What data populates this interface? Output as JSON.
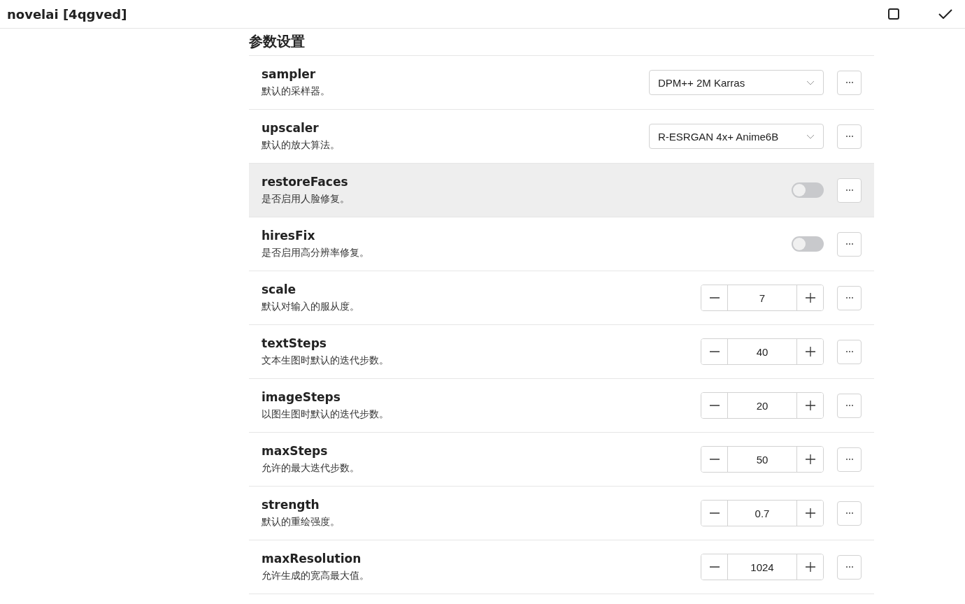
{
  "header": {
    "title": "novelai [4qgved]"
  },
  "section": {
    "title": "参数设置"
  },
  "settings": [
    {
      "name": "sampler",
      "description": "默认的采样器。",
      "kind": "select",
      "value": "DPM++ 2M Karras",
      "hovered": false
    },
    {
      "name": "upscaler",
      "description": "默认的放大算法。",
      "kind": "select",
      "value": "R-ESRGAN 4x+ Anime6B",
      "hovered": false
    },
    {
      "name": "restoreFaces",
      "description": "是否启用人脸修复。",
      "kind": "switch",
      "on": false,
      "hovered": true
    },
    {
      "name": "hiresFix",
      "description": "是否启用高分辨率修复。",
      "kind": "switch",
      "on": false,
      "hovered": false
    },
    {
      "name": "scale",
      "description": "默认对输入的服从度。",
      "kind": "number",
      "value": "7",
      "hovered": false
    },
    {
      "name": "textSteps",
      "description": "文本生图时默认的迭代步数。",
      "kind": "number",
      "value": "40",
      "hovered": false
    },
    {
      "name": "imageSteps",
      "description": "以图生图时默认的迭代步数。",
      "kind": "number",
      "value": "20",
      "hovered": false
    },
    {
      "name": "maxSteps",
      "description": "允许的最大迭代步数。",
      "kind": "number",
      "value": "50",
      "hovered": false
    },
    {
      "name": "strength",
      "description": "默认的重绘强度。",
      "kind": "number",
      "value": "0.7",
      "hovered": false
    },
    {
      "name": "maxResolution",
      "description": "允许生成的宽高最大值。",
      "kind": "number",
      "value": "1024",
      "hovered": false
    }
  ]
}
